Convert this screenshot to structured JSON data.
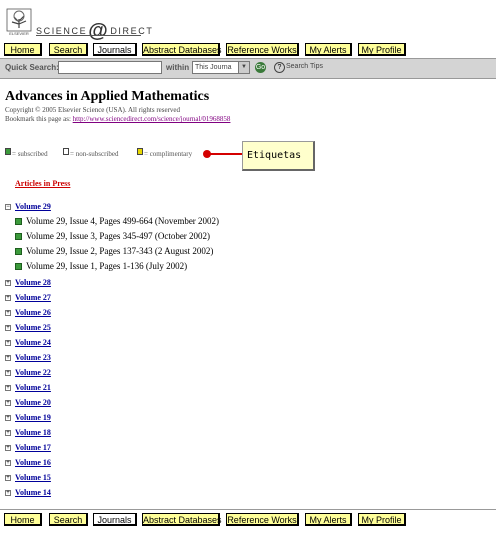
{
  "header": {
    "logo_text_left": "SCIENCE",
    "logo_at": "@",
    "logo_text_right": "DIRECT",
    "publisher_text": "ELSEVIER"
  },
  "nav": {
    "items": [
      "Home",
      "Search",
      "Journals",
      "Abstract Databases",
      "Reference Works",
      "My Alerts",
      "My Profile"
    ],
    "active": "Journals"
  },
  "quick_search": {
    "label": "Quick Search:",
    "value": "",
    "within_label": "within",
    "scope_value": "This Journa",
    "go_label": "Go",
    "help_glyph": "?",
    "tips_label": "Search Tips"
  },
  "journal": {
    "title": "Advances in Applied Mathematics",
    "copyright": "Copyright © 2005 Elsevier Science (USA). All rights reserved",
    "bookmark_label": "Bookmark this page as:",
    "bookmark_url": "http://www.sciencedirect.com/science/journal/01968858"
  },
  "legend": {
    "subscribed": "= subscribed",
    "non_subscribed": "= non-subscribed",
    "complimentary": "= complimentary",
    "colors": {
      "subscribed": "#3c9a3c",
      "non_subscribed": "#ffffff",
      "complimentary": "#e8d800"
    }
  },
  "callout": {
    "label": "Etiquetas",
    "color": "#d40000"
  },
  "articles_in_press": "Articles in Press",
  "expanded_volume": {
    "label": "Volume 29",
    "issues": [
      "Volume 29, Issue 4, Pages 499-664 (November 2002)",
      "Volume 29, Issue 3, Pages 345-497 (October 2002)",
      "Volume 29, Issue 2, Pages 137-343 (2 August 2002)",
      "Volume 29, Issue 1, Pages 1-136 (July 2002)"
    ]
  },
  "collapsed_volumes": [
    "Volume 28",
    "Volume 27",
    "Volume 26",
    "Volume 25",
    "Volume 24",
    "Volume 23",
    "Volume 22",
    "Volume 21",
    "Volume 20",
    "Volume 19",
    "Volume 18",
    "Volume 17",
    "Volume 16",
    "Volume 15",
    "Volume 14"
  ],
  "colors": {
    "nav_button": "#ffff99",
    "link": "#000099",
    "press_link": "#cc0000",
    "visited": "#800080"
  }
}
